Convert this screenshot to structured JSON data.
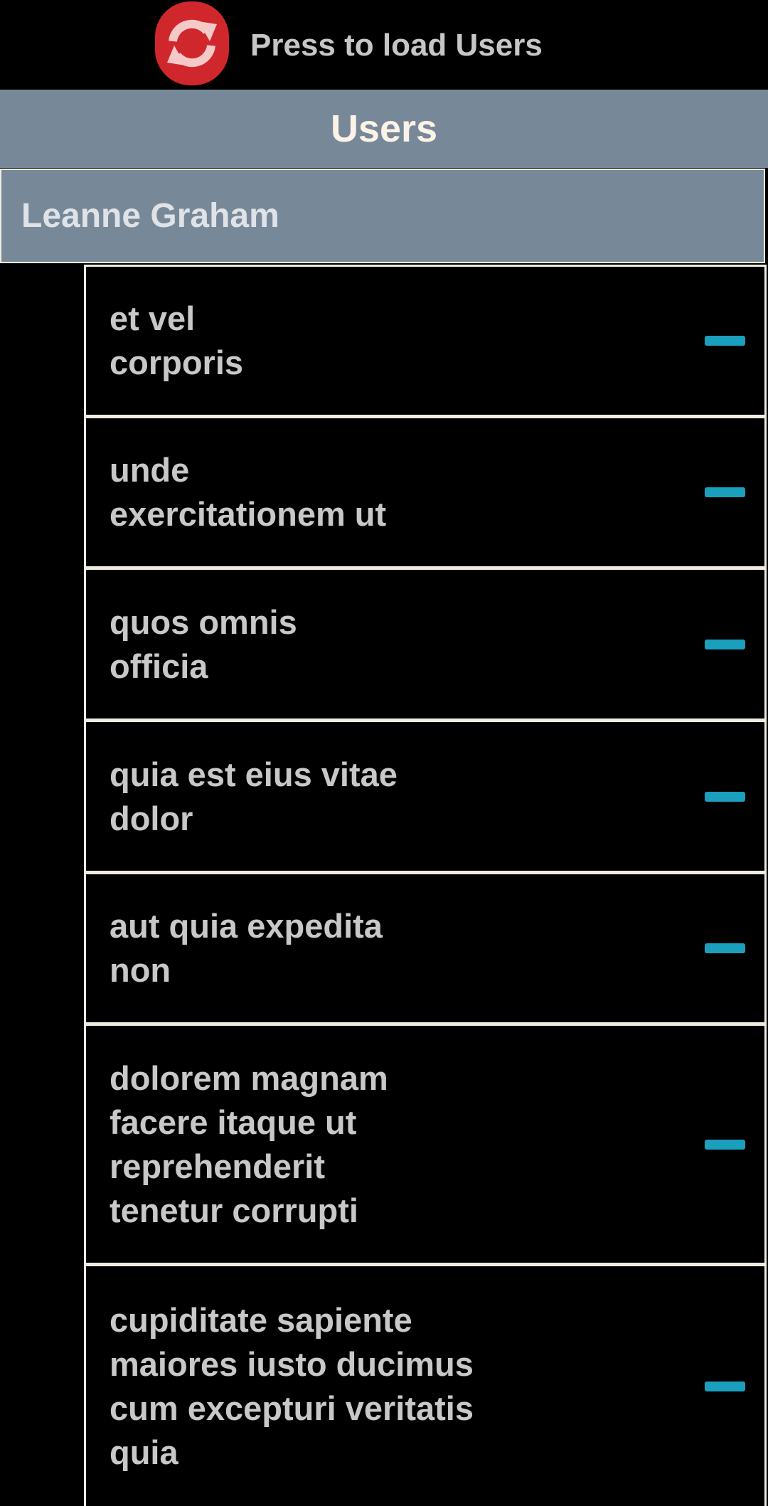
{
  "top_bar": {
    "load_icon": "refresh-icon",
    "load_label": "Press to load Users",
    "accent_color": "#d0272d"
  },
  "section": {
    "title": "Users",
    "header_color": "#778899"
  },
  "user": {
    "name": "Leanne Graham"
  },
  "posts": [
    {
      "title": "et vel\ncorporis",
      "action_icon": "minus-icon"
    },
    {
      "title": "unde\nexercitationem ut",
      "action_icon": "minus-icon"
    },
    {
      "title": "quos omnis\nofficia",
      "action_icon": "minus-icon"
    },
    {
      "title": "quia est eius vitae\ndolor",
      "action_icon": "minus-icon"
    },
    {
      "title": "aut quia expedita\nnon",
      "action_icon": "minus-icon"
    },
    {
      "title": "dolorem magnam\nfacere itaque ut\nreprehenderit\ntenetur corrupti",
      "action_icon": "minus-icon"
    },
    {
      "title": "cupiditate sapiente\nmaiores iusto ducimus\ncum excepturi veritatis\nquia",
      "action_icon": "minus-icon"
    }
  ],
  "colors": {
    "minus_button": "#1a9fbd",
    "border": "#f0ebe0"
  }
}
